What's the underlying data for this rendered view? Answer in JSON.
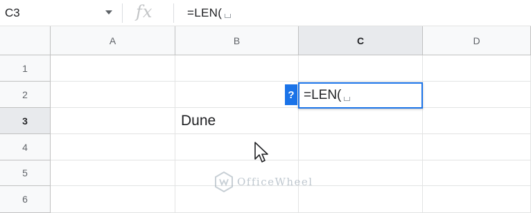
{
  "formula_bar": {
    "name_box": "C3",
    "fx_label": "fx",
    "formula": "=LEN("
  },
  "columns": [
    {
      "label": "A",
      "active": false
    },
    {
      "label": "B",
      "active": false
    },
    {
      "label": "C",
      "active": true
    },
    {
      "label": "D",
      "active": false
    }
  ],
  "rows": [
    {
      "label": "1",
      "active": false
    },
    {
      "label": "2",
      "active": false
    },
    {
      "label": "3",
      "active": true
    },
    {
      "label": "4",
      "active": false
    },
    {
      "label": "5",
      "active": false
    },
    {
      "label": "6",
      "active": false
    }
  ],
  "cells": {
    "B3": "Dune"
  },
  "active_cell": {
    "ref": "C3",
    "editing_text": "=LEN(",
    "help_label": "?"
  },
  "watermark": {
    "text": "OfficeWheel"
  },
  "colors": {
    "accent": "#1a73e8",
    "header_bg": "#f8f9fa",
    "header_active_bg": "#e8eaed",
    "gridline": "#e2e3e3"
  }
}
